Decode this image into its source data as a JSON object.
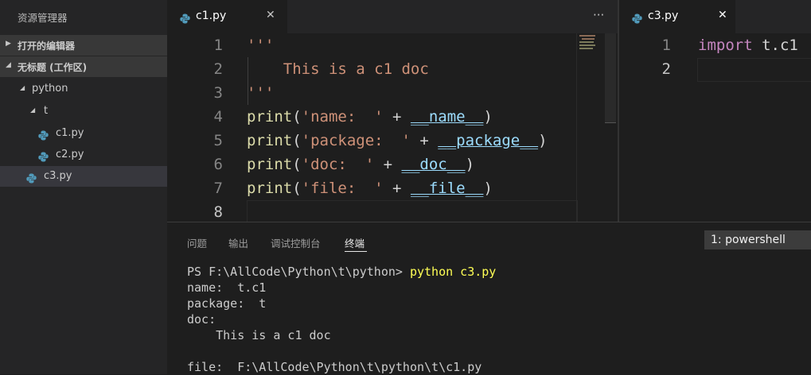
{
  "sidebar": {
    "title": "资源管理器",
    "open_editors": "打开的编辑器",
    "workspace": "无标题 (工作区)",
    "tree": [
      {
        "label": "python"
      },
      {
        "label": "t"
      },
      {
        "label": "c1.py"
      },
      {
        "label": "c2.py"
      },
      {
        "label": "c3.py"
      }
    ]
  },
  "editor_left": {
    "tab_label": "c1.py",
    "tab_close": "✕",
    "more": "···",
    "line_numbers": [
      "1",
      "2",
      "3",
      "4",
      "5",
      "6",
      "7",
      "8"
    ],
    "lines": [
      [
        {
          "t": "str",
          "v": "'''"
        }
      ],
      [
        {
          "t": "str",
          "v": "    This is a c1 doc"
        }
      ],
      [
        {
          "t": "str",
          "v": "'''"
        }
      ],
      [
        {
          "t": "fn",
          "v": "print"
        },
        {
          "t": "op",
          "v": "("
        },
        {
          "t": "str",
          "v": "'name:  '"
        },
        {
          "t": "op",
          "v": " + "
        },
        {
          "t": "var",
          "v": "__name__"
        },
        {
          "t": "op",
          "v": ")"
        }
      ],
      [
        {
          "t": "fn",
          "v": "print"
        },
        {
          "t": "op",
          "v": "("
        },
        {
          "t": "str",
          "v": "'package:  '"
        },
        {
          "t": "op",
          "v": " + "
        },
        {
          "t": "var",
          "v": "__package__"
        },
        {
          "t": "op",
          "v": ")"
        }
      ],
      [
        {
          "t": "fn",
          "v": "print"
        },
        {
          "t": "op",
          "v": "("
        },
        {
          "t": "str",
          "v": "'doc:  '"
        },
        {
          "t": "op",
          "v": " + "
        },
        {
          "t": "var",
          "v": "__doc__"
        },
        {
          "t": "op",
          "v": ")"
        }
      ],
      [
        {
          "t": "fn",
          "v": "print"
        },
        {
          "t": "op",
          "v": "("
        },
        {
          "t": "str",
          "v": "'file:  '"
        },
        {
          "t": "op",
          "v": " + "
        },
        {
          "t": "var",
          "v": "__file__"
        },
        {
          "t": "op",
          "v": ")"
        }
      ],
      []
    ]
  },
  "editor_right": {
    "tab_label": "c3.py",
    "tab_close": "✕",
    "line_numbers": [
      "1",
      "2"
    ],
    "lines": [
      [
        {
          "t": "kw",
          "v": "import"
        },
        {
          "t": "op",
          "v": " t.c1"
        }
      ],
      []
    ]
  },
  "panel": {
    "tabs": [
      "问题",
      "输出",
      "调试控制台",
      "终端"
    ],
    "active_tab": "终端",
    "terminal_select": "1: powershell",
    "terminal": {
      "prompt": "PS F:\\AllCode\\Python\\t\\python> ",
      "command": "python c3.py",
      "output": [
        "name:  t.c1",
        "package:  t",
        "doc:",
        "    This is a c1 doc",
        "",
        "file:  F:\\AllCode\\Python\\t\\python\\t\\c1.py"
      ]
    }
  },
  "colors": {
    "accent_python_icon": "#519aba",
    "string": "#ce9178",
    "function": "#dcdcaa",
    "variable": "#9cdcfe",
    "keyword": "#c586c0",
    "terminal_command": "#ffff55"
  }
}
